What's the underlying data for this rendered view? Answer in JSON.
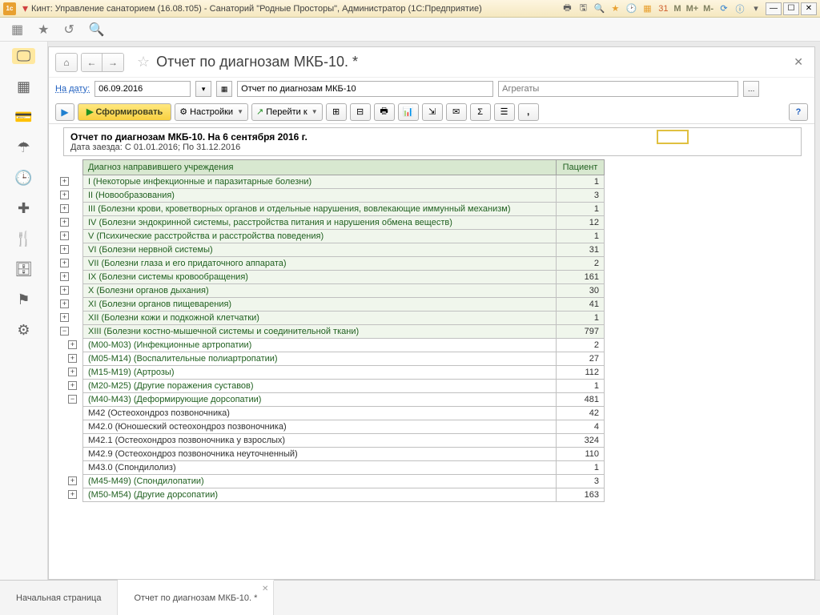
{
  "titlebar": {
    "logo": "1c",
    "title": "Кинт: Управление санаторием (16.08.т05) - Санаторий \"Родные Просторы\", Администратор  (1С:Предприятие)",
    "m_buttons": [
      "M",
      "M+",
      "M-"
    ]
  },
  "page": {
    "title": "Отчет по диагнозам МКБ-10. *"
  },
  "filter": {
    "date_label": "На дату:",
    "date_value": "06.09.2016",
    "desc": "Отчет по диагнозам МКБ-10",
    "agg_placeholder": "Агрегаты"
  },
  "actions": {
    "form": "Сформировать",
    "settings": "Настройки",
    "goto": "Перейти к"
  },
  "report": {
    "title": "Отчет по диагнозам МКБ-10. На 6 сентября 2016 г.",
    "subtitle": "Дата заезда: С 01.01.2016; По 31.12.2016",
    "col_diag": "Диагноз направившего учреждения",
    "col_pat": "Пациент",
    "rows": [
      {
        "exp": "+",
        "lvl": 0,
        "t": "I (Некоторые инфекционные и паразитарные болезни)",
        "v": "1"
      },
      {
        "exp": "+",
        "lvl": 0,
        "t": "II (Новообразования)",
        "v": "3"
      },
      {
        "exp": "+",
        "lvl": 0,
        "t": "III (Болезни крови, кроветворных органов и отдельные нарушения, вовлекающие иммунный механизм)",
        "v": "1"
      },
      {
        "exp": "+",
        "lvl": 0,
        "t": "IV (Болезни эндокринной системы, расстройства питания и нарушения обмена веществ)",
        "v": "12"
      },
      {
        "exp": "+",
        "lvl": 0,
        "t": "V (Психические расстройства и расстройства поведения)",
        "v": "1"
      },
      {
        "exp": "+",
        "lvl": 0,
        "t": "VI (Болезни нервной системы)",
        "v": "31"
      },
      {
        "exp": "+",
        "lvl": 0,
        "t": "VII (Болезни глаза и его придаточного аппарата)",
        "v": "2"
      },
      {
        "exp": "+",
        "lvl": 0,
        "t": "IX (Болезни системы кровообращения)",
        "v": "161"
      },
      {
        "exp": "+",
        "lvl": 0,
        "t": "X (Болезни органов дыхания)",
        "v": "30"
      },
      {
        "exp": "+",
        "lvl": 0,
        "t": "XI (Болезни органов пищеварения)",
        "v": "41"
      },
      {
        "exp": "+",
        "lvl": 0,
        "t": "XII (Болезни кожи и подкожной клетчатки)",
        "v": "1"
      },
      {
        "exp": "−",
        "lvl": 0,
        "t": "XIII (Болезни костно-мышечной системы и соединительной ткани)",
        "v": "797"
      },
      {
        "exp": "+",
        "lvl": 1,
        "t": "(M00-M03) (Инфекционные артропатии)",
        "v": "2",
        "cls": "sub"
      },
      {
        "exp": "+",
        "lvl": 1,
        "t": "(M05-M14) (Воспалительные полиартропатии)",
        "v": "27",
        "cls": "sub"
      },
      {
        "exp": "+",
        "lvl": 1,
        "t": "(M15-M19) (Артрозы)",
        "v": "112",
        "cls": "sub"
      },
      {
        "exp": "+",
        "lvl": 1,
        "t": "(M20-M25) (Другие поражения суставов)",
        "v": "1",
        "cls": "sub"
      },
      {
        "exp": "−",
        "lvl": 1,
        "t": "(M40-M43) (Деформирующие дорсопатии)",
        "v": "481",
        "cls": "sub"
      },
      {
        "exp": "",
        "lvl": 2,
        "t": "M42 (Остеохондроз позвоночника)",
        "v": "42",
        "cls": "sub2"
      },
      {
        "exp": "",
        "lvl": 2,
        "t": "M42.0 (Юношеский остеохондроз позвоночника)",
        "v": "4",
        "cls": "sub2"
      },
      {
        "exp": "",
        "lvl": 2,
        "t": "M42.1 (Остеохондроз позвоночника у взрослых)",
        "v": "324",
        "cls": "sub2"
      },
      {
        "exp": "",
        "lvl": 2,
        "t": "M42.9 (Остеохондроз позвоночника неуточненный)",
        "v": "110",
        "cls": "sub2"
      },
      {
        "exp": "",
        "lvl": 2,
        "t": "M43.0 (Спондилолиз)",
        "v": "1",
        "cls": "sub2"
      },
      {
        "exp": "+",
        "lvl": 1,
        "t": "(M45-M49) (Спондилопатии)",
        "v": "3",
        "cls": "sub"
      },
      {
        "exp": "+",
        "lvl": 1,
        "t": "(M50-M54) (Другие дорсопатии)",
        "v": "163",
        "cls": "sub"
      }
    ]
  },
  "tabs": {
    "start": "Начальная страница",
    "report": "Отчет по диагнозам МКБ-10. *"
  }
}
